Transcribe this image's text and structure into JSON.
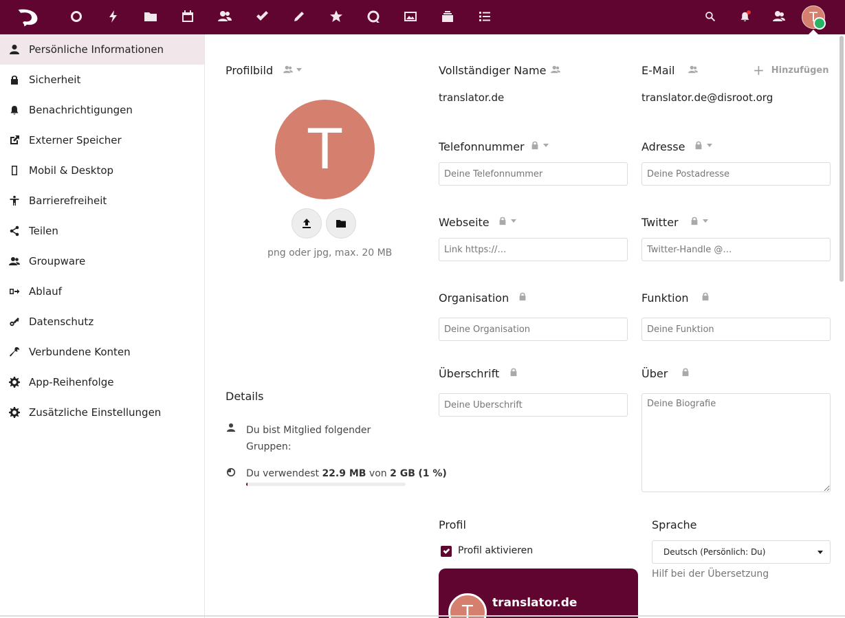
{
  "header": {
    "icons": [
      "logo-icon",
      "dashboard-icon",
      "activity-icon",
      "files-icon",
      "calendar-icon",
      "contacts-icon",
      "tasks-icon",
      "notes-icon",
      "bookmarks-icon",
      "talk-icon",
      "photos-icon",
      "deck-icon",
      "forms-icon",
      "search-icon",
      "notifications-icon",
      "contacts-menu-icon"
    ],
    "avatar_letter": "T",
    "accent": "#5f0530"
  },
  "sidebar": {
    "items": [
      {
        "label": "Persönliche Informationen",
        "icon": "user-icon",
        "active": true
      },
      {
        "label": "Sicherheit",
        "icon": "lock-icon"
      },
      {
        "label": "Benachrichtigungen",
        "icon": "bell-icon"
      },
      {
        "label": "Externer Speicher",
        "icon": "external-link-icon"
      },
      {
        "label": "Mobil & Desktop",
        "icon": "phone-icon"
      },
      {
        "label": "Barrierefreiheit",
        "icon": "accessibility-icon"
      },
      {
        "label": "Teilen",
        "icon": "share-icon"
      },
      {
        "label": "Groupware",
        "icon": "group-icon"
      },
      {
        "label": "Ablauf",
        "icon": "flow-icon"
      },
      {
        "label": "Datenschutz",
        "icon": "key-icon"
      },
      {
        "label": "Verbundene Konten",
        "icon": "wrench-icon"
      },
      {
        "label": "App-Reihenfolge",
        "icon": "gear-icon"
      },
      {
        "label": "Zusätzliche Einstellungen",
        "icon": "gear-icon"
      }
    ]
  },
  "profile_picture": {
    "title": "Profilbild",
    "avatar_letter": "T",
    "hint": "png oder jpg, max. 20 MB"
  },
  "details": {
    "title": "Details",
    "groups_text": "Du bist Mitglied folgender Gruppen:",
    "usage_prefix": "Du verwendest ",
    "usage_used": "22.9 MB",
    "usage_mid": " von ",
    "usage_total": "2 GB",
    "usage_percent": "(1 %)",
    "usage_fraction": 0.01
  },
  "fields": {
    "fullname": {
      "label": "Vollständiger Name",
      "value": "translator.de"
    },
    "email": {
      "label": "E-Mail",
      "value": "translator.de@disroot.org",
      "add_label": "Hinzufügen"
    },
    "phone": {
      "label": "Telefonnummer",
      "placeholder": "Deine Telefonnummer"
    },
    "address": {
      "label": "Adresse",
      "placeholder": "Deine Postadresse"
    },
    "website": {
      "label": "Webseite",
      "placeholder": "Link https://…"
    },
    "twitter": {
      "label": "Twitter",
      "placeholder": "Twitter-Handle @…"
    },
    "organisation": {
      "label": "Organisation",
      "placeholder": "Deine Organisation"
    },
    "role": {
      "label": "Funktion",
      "placeholder": "Deine Funktion"
    },
    "headline": {
      "label": "Überschrift",
      "placeholder": "Deine Überschrift"
    },
    "about": {
      "label": "Über",
      "placeholder": "Deine Biografie"
    }
  },
  "profile": {
    "title": "Profil",
    "enable_label": "Profil aktivieren",
    "enabled": true,
    "card_name": "translator.de",
    "card_avatar_letter": "T"
  },
  "language": {
    "title": "Sprache",
    "selected": "Deutsch (Persönlich: Du)",
    "help_link": "Hilf bei der Übersetzung"
  }
}
